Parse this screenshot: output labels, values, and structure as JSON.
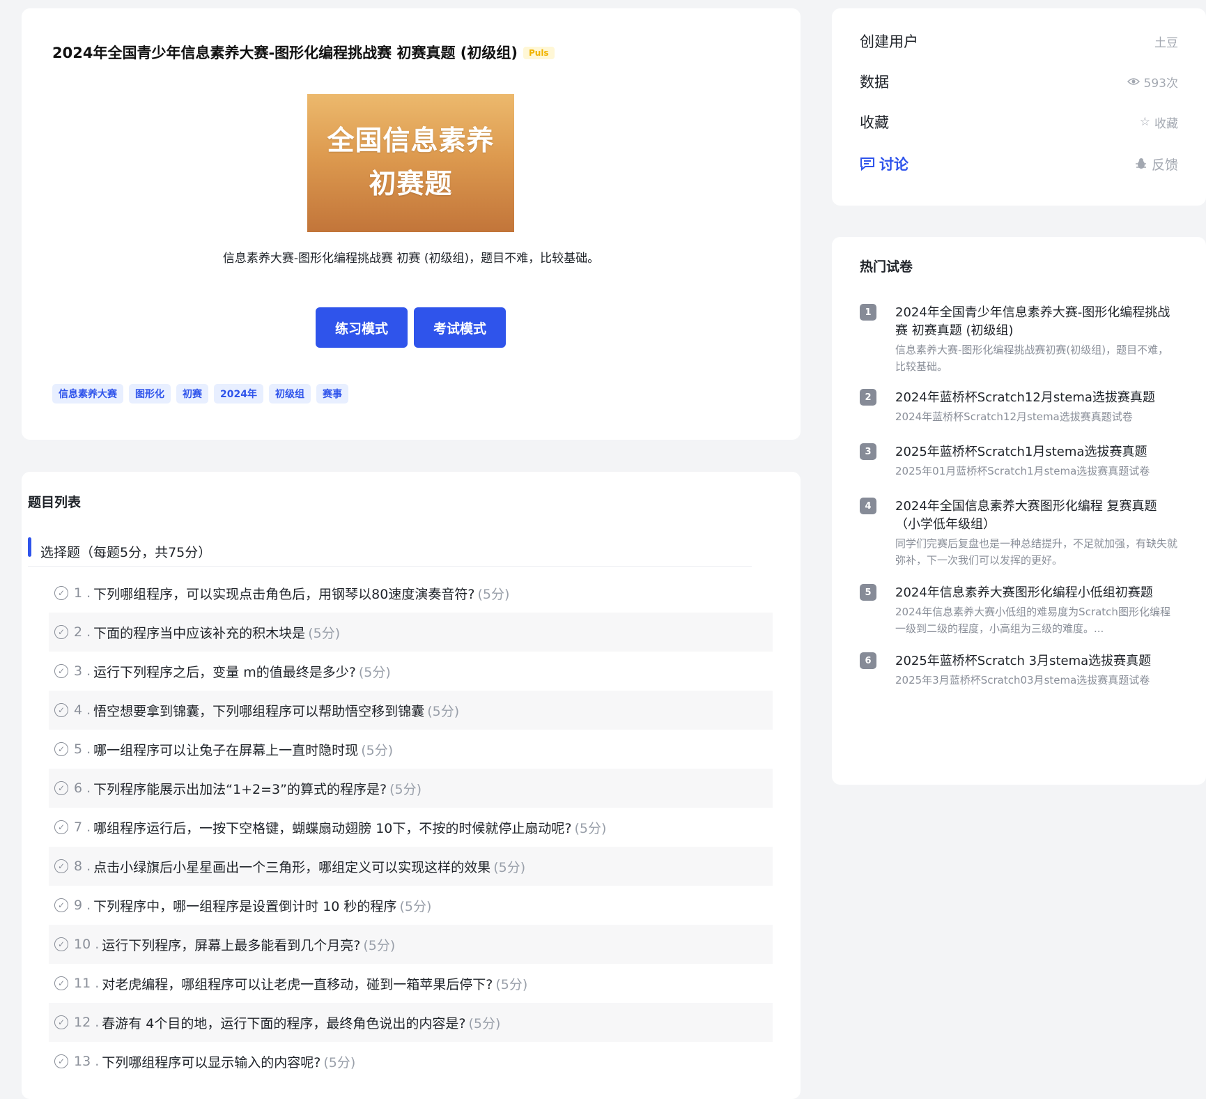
{
  "hero": {
    "title": "2024年全国青少年信息素养大赛-图形化编程挑战赛 初赛真题 (初级组)",
    "badge": "Puls",
    "cover_line1": "全国信息素养",
    "cover_line2": "初赛题",
    "description": "信息素养大赛-图形化编程挑战赛 初赛 (初级组)，题目不难，比较基础。",
    "practice_label": "练习模式",
    "exam_label": "考试模式",
    "tags": [
      "信息素养大赛",
      "图形化",
      "初赛",
      "2024年",
      "初级组",
      "赛事"
    ]
  },
  "question_list": {
    "title": "题目列表",
    "group_title": "选择题（每题5分，共75分）",
    "questions": [
      {
        "num": "1 .",
        "text": "下列哪组程序，可以实现点击角色后，用钢琴以80速度演奏音符?",
        "score": "(5分)"
      },
      {
        "num": "2 .",
        "text": "下面的程序当中应该补充的积木块是",
        "score": "(5分)"
      },
      {
        "num": "3 .",
        "text": "运行下列程序之后，变量 m的值最终是多少?",
        "score": "(5分)"
      },
      {
        "num": "4 .",
        "text": "悟空想要拿到锦囊，下列哪组程序可以帮助悟空移到锦囊",
        "score": "(5分)"
      },
      {
        "num": "5 .",
        "text": "哪一组程序可以让兔子在屏幕上一直时隐时现",
        "score": "(5分)"
      },
      {
        "num": "6 .",
        "text": "下列程序能展示出加法“1+2=3”的算式的程序是?",
        "score": "(5分)"
      },
      {
        "num": "7 .",
        "text": "哪组程序运行后，一按下空格键，蝴蝶扇动翅膀 10下，不按的时候就停止扇动呢?",
        "score": "(5分)"
      },
      {
        "num": "8 .",
        "text": "点击小绿旗后小星星画出一个三角形，哪组定义可以实现这样的效果",
        "score": "(5分)"
      },
      {
        "num": "9 .",
        "text": "下列程序中，哪一组程序是设置倒计时 10 秒的程序",
        "score": "(5分)"
      },
      {
        "num": "10 .",
        "text": "运行下列程序，屏幕上最多能看到几个月亮?",
        "score": "(5分)"
      },
      {
        "num": "11 .",
        "text": "对老虎编程，哪组程序可以让老虎一直移动，碰到一箱苹果后停下?",
        "score": "(5分)"
      },
      {
        "num": "12 .",
        "text": "春游有 4个目的地，运行下面的程序，最终角色说出的内容是?",
        "score": "(5分)"
      },
      {
        "num": "13 .",
        "text": "下列哪组程序可以显示输入的内容呢?",
        "score": "(5分)"
      }
    ]
  },
  "meta": {
    "creator_label": "创建用户",
    "creator_value": "土豆",
    "data_label": "数据",
    "data_value": "593次",
    "favorite_label": "收藏",
    "favorite_value": "收藏",
    "discuss_label": "讨论",
    "feedback_value": "反馈"
  },
  "hot": {
    "title": "热门试卷",
    "items": [
      {
        "rank": "1",
        "name": "2024年全国青少年信息素养大赛-图形化编程挑战赛 初赛真题 (初级组)",
        "desc": "信息素养大赛-图形化编程挑战赛初赛(初级组)，题目不难，比较基础。"
      },
      {
        "rank": "2",
        "name": "2024年蓝桥杯Scratch12月stema选拔赛真题",
        "desc": "2024年蓝桥杯Scratch12月stema选拔赛真题试卷"
      },
      {
        "rank": "3",
        "name": "2025年蓝桥杯Scratch1月stema选拔赛真题",
        "desc": "2025年01月蓝桥杯Scratch1月stema选拔赛真题试卷"
      },
      {
        "rank": "4",
        "name": "2024年全国信息素养大赛图形化编程 复赛真题（小学低年级组）",
        "desc": "同学们完赛后复盘也是一种总结提升，不足就加强，有缺失就弥补，下一次我们可以发挥的更好。"
      },
      {
        "rank": "5",
        "name": "2024年信息素养大赛图形化编程小低组初赛题",
        "desc": "2024年信息素养大赛小低组的难易度为Scratch图形化编程一级到二级的程度，小高组为三级的难度。..."
      },
      {
        "rank": "6",
        "name": "2025年蓝桥杯Scratch 3月stema选拔赛真题",
        "desc": "2025年3月蓝桥杯Scratch03月stema选拔赛真题试卷"
      }
    ]
  },
  "colors": {
    "accent": "#2f54eb",
    "badge": "#f0b400",
    "rank_bg": "#868b97"
  }
}
